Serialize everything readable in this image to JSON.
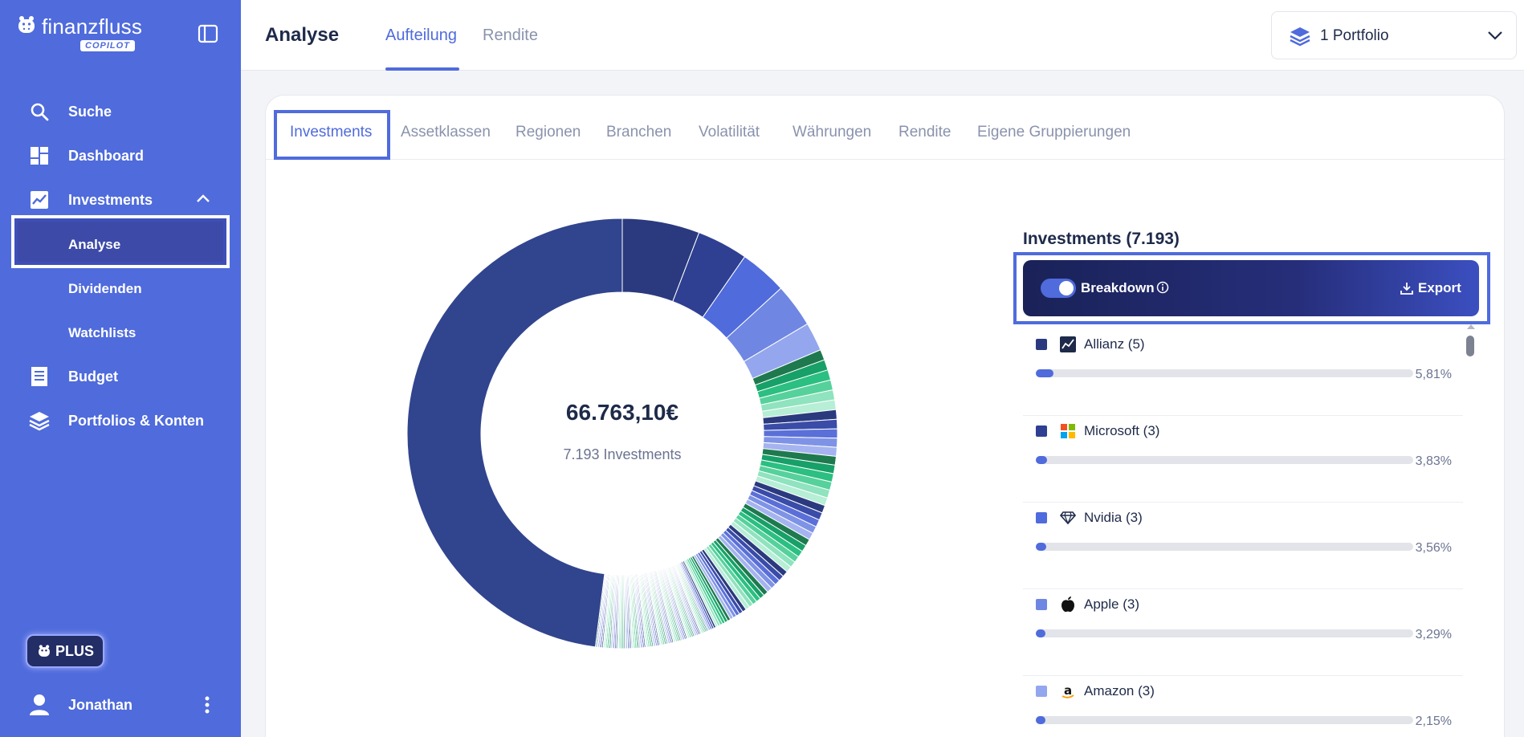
{
  "app": {
    "logo_text": "finanzfluss",
    "logo_badge": "COPILOT"
  },
  "sidebar": {
    "items": [
      {
        "label": "Suche",
        "icon": "search-icon"
      },
      {
        "label": "Dashboard",
        "icon": "dashboard-icon"
      },
      {
        "label": "Investments",
        "icon": "chart-line-icon",
        "expanded": true
      },
      {
        "label": "Analyse",
        "active": true
      },
      {
        "label": "Dividenden"
      },
      {
        "label": "Watchlists"
      },
      {
        "label": "Budget",
        "icon": "receipt-icon"
      },
      {
        "label": "Portfolios & Konten",
        "icon": "layers-icon"
      }
    ],
    "plus_label": "PLUS",
    "user_name": "Jonathan"
  },
  "header": {
    "title": "Analyse",
    "tabs": [
      {
        "label": "Aufteilung",
        "active": true
      },
      {
        "label": "Rendite",
        "active": false
      }
    ],
    "portfolio_select": "1 Portfolio"
  },
  "subtabs": [
    {
      "label": "Investments",
      "active": true
    },
    {
      "label": "Assetklassen"
    },
    {
      "label": "Regionen"
    },
    {
      "label": "Branchen"
    },
    {
      "label": "Volatilität"
    },
    {
      "label": "Währungen"
    },
    {
      "label": "Rendite"
    },
    {
      "label": "Eigene Gruppierungen"
    }
  ],
  "donut": {
    "total_value": "66.763,10€",
    "subtitle": "7.193 Investments"
  },
  "chart_data": {
    "type": "pie",
    "slices": [
      {
        "label": "Allianz (5)",
        "percent": 5.81,
        "color": "#2b3a7e"
      },
      {
        "label": "Microsoft (3)",
        "percent": 3.83,
        "color": "#2f3f92"
      },
      {
        "label": "Nvidia (3)",
        "percent": 3.56,
        "color": "#4f6bdc"
      },
      {
        "label": "Apple (3)",
        "percent": 3.29,
        "color": "#6f86e2"
      },
      {
        "label": "Amazon (3)",
        "percent": 2.15,
        "color": "#93a6ee"
      }
    ]
  },
  "investments_panel": {
    "title": "Investments (7.193)",
    "breakdown_label": "Breakdown",
    "breakdown_on": true,
    "export_label": "Export",
    "rows": [
      {
        "name": "Allianz (5)",
        "percent": "5,81%",
        "value": 5.81,
        "color": "#2b3a7e",
        "icon": "chart-line-logo-icon"
      },
      {
        "name": "Microsoft (3)",
        "percent": "3,83%",
        "value": 3.83,
        "color": "#2f3f92",
        "icon": "microsoft-logo-icon"
      },
      {
        "name": "Nvidia (3)",
        "percent": "3,56%",
        "value": 3.56,
        "color": "#4f6bdc",
        "icon": "diamond-icon"
      },
      {
        "name": "Apple (3)",
        "percent": "3,29%",
        "value": 3.29,
        "color": "#6f86e2",
        "icon": "apple-logo-icon"
      },
      {
        "name": "Amazon (3)",
        "percent": "2,15%",
        "value": 2.15,
        "color": "#93a6ee",
        "icon": "amazon-logo-icon"
      }
    ]
  },
  "colors": {
    "accent": "#4f6bdc",
    "sidebar_bg": "#4f6bdc",
    "text_dark": "#1e2a4a"
  }
}
